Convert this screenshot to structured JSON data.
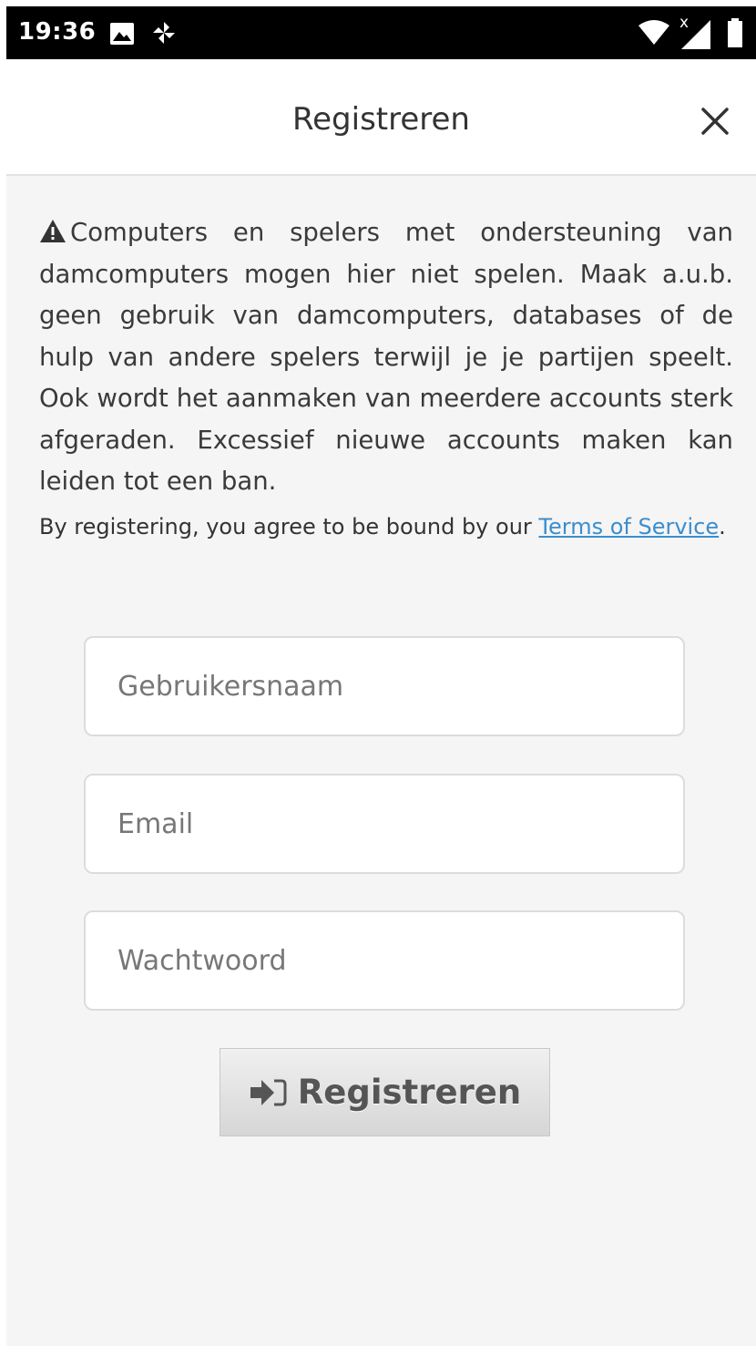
{
  "status_bar": {
    "time": "19:36",
    "icons": [
      "image-icon",
      "pinwheel-icon",
      "wifi-icon",
      "signal-no-data-icon",
      "battery-icon"
    ],
    "signal_badge": "x"
  },
  "header": {
    "title": "Registreren",
    "close_icon": "close-icon"
  },
  "warning": {
    "icon": "warning-triangle-icon",
    "text": "Computers en spelers met ondersteuning van damcomputers mogen hier niet spelen. Maak a.u.b. geen gebruik van damcomputers, databases of de hulp van andere spelers terwijl je je partijen speelt. Ook wordt het aanmaken van meerdere accounts sterk afgeraden. Excessief nieuwe accounts maken kan leiden tot een ban."
  },
  "terms": {
    "prefix": "By registering, you agree to be bound by our ",
    "link": "Terms of Service",
    "suffix": "."
  },
  "form": {
    "username": {
      "value": "",
      "placeholder": "Gebruikersnaam"
    },
    "email": {
      "value": "",
      "placeholder": "Email"
    },
    "password": {
      "value": "",
      "placeholder": "Wachtwoord"
    },
    "submit": {
      "label": "Registreren",
      "icon": "sign-in-icon"
    }
  },
  "colors": {
    "link": "#3a8ecf",
    "background": "#f5f5f5",
    "status_bar": "#000000"
  }
}
